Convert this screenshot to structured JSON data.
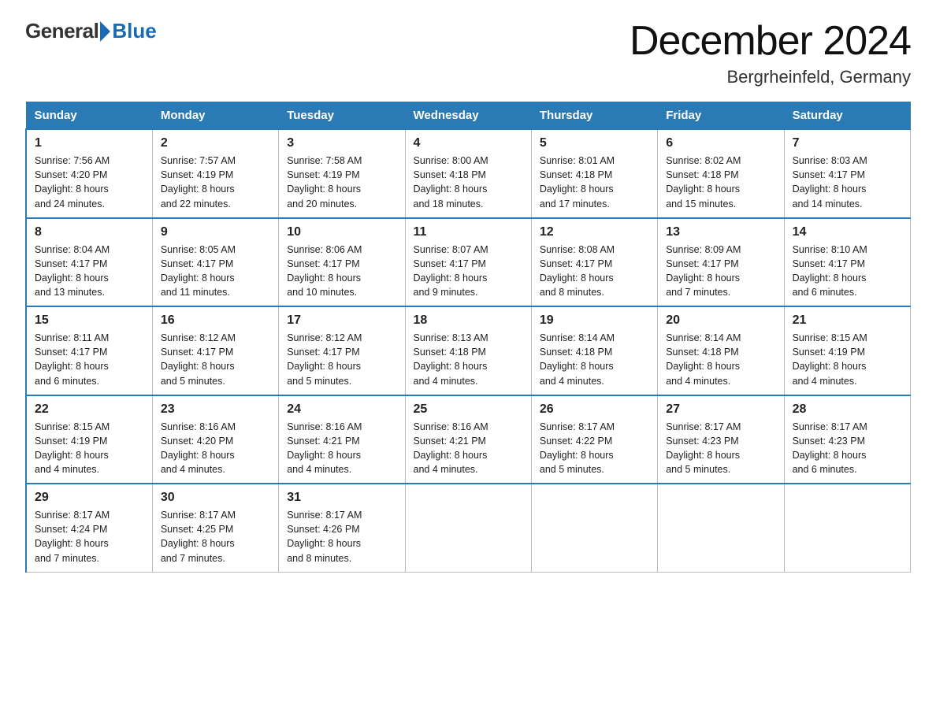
{
  "header": {
    "logo_general": "General",
    "logo_blue": "Blue",
    "title": "December 2024",
    "subtitle": "Bergrheinfeld, Germany"
  },
  "days_of_week": [
    "Sunday",
    "Monday",
    "Tuesday",
    "Wednesday",
    "Thursday",
    "Friday",
    "Saturday"
  ],
  "weeks": [
    [
      {
        "day": "1",
        "info": "Sunrise: 7:56 AM\nSunset: 4:20 PM\nDaylight: 8 hours\nand 24 minutes."
      },
      {
        "day": "2",
        "info": "Sunrise: 7:57 AM\nSunset: 4:19 PM\nDaylight: 8 hours\nand 22 minutes."
      },
      {
        "day": "3",
        "info": "Sunrise: 7:58 AM\nSunset: 4:19 PM\nDaylight: 8 hours\nand 20 minutes."
      },
      {
        "day": "4",
        "info": "Sunrise: 8:00 AM\nSunset: 4:18 PM\nDaylight: 8 hours\nand 18 minutes."
      },
      {
        "day": "5",
        "info": "Sunrise: 8:01 AM\nSunset: 4:18 PM\nDaylight: 8 hours\nand 17 minutes."
      },
      {
        "day": "6",
        "info": "Sunrise: 8:02 AM\nSunset: 4:18 PM\nDaylight: 8 hours\nand 15 minutes."
      },
      {
        "day": "7",
        "info": "Sunrise: 8:03 AM\nSunset: 4:17 PM\nDaylight: 8 hours\nand 14 minutes."
      }
    ],
    [
      {
        "day": "8",
        "info": "Sunrise: 8:04 AM\nSunset: 4:17 PM\nDaylight: 8 hours\nand 13 minutes."
      },
      {
        "day": "9",
        "info": "Sunrise: 8:05 AM\nSunset: 4:17 PM\nDaylight: 8 hours\nand 11 minutes."
      },
      {
        "day": "10",
        "info": "Sunrise: 8:06 AM\nSunset: 4:17 PM\nDaylight: 8 hours\nand 10 minutes."
      },
      {
        "day": "11",
        "info": "Sunrise: 8:07 AM\nSunset: 4:17 PM\nDaylight: 8 hours\nand 9 minutes."
      },
      {
        "day": "12",
        "info": "Sunrise: 8:08 AM\nSunset: 4:17 PM\nDaylight: 8 hours\nand 8 minutes."
      },
      {
        "day": "13",
        "info": "Sunrise: 8:09 AM\nSunset: 4:17 PM\nDaylight: 8 hours\nand 7 minutes."
      },
      {
        "day": "14",
        "info": "Sunrise: 8:10 AM\nSunset: 4:17 PM\nDaylight: 8 hours\nand 6 minutes."
      }
    ],
    [
      {
        "day": "15",
        "info": "Sunrise: 8:11 AM\nSunset: 4:17 PM\nDaylight: 8 hours\nand 6 minutes."
      },
      {
        "day": "16",
        "info": "Sunrise: 8:12 AM\nSunset: 4:17 PM\nDaylight: 8 hours\nand 5 minutes."
      },
      {
        "day": "17",
        "info": "Sunrise: 8:12 AM\nSunset: 4:17 PM\nDaylight: 8 hours\nand 5 minutes."
      },
      {
        "day": "18",
        "info": "Sunrise: 8:13 AM\nSunset: 4:18 PM\nDaylight: 8 hours\nand 4 minutes."
      },
      {
        "day": "19",
        "info": "Sunrise: 8:14 AM\nSunset: 4:18 PM\nDaylight: 8 hours\nand 4 minutes."
      },
      {
        "day": "20",
        "info": "Sunrise: 8:14 AM\nSunset: 4:18 PM\nDaylight: 8 hours\nand 4 minutes."
      },
      {
        "day": "21",
        "info": "Sunrise: 8:15 AM\nSunset: 4:19 PM\nDaylight: 8 hours\nand 4 minutes."
      }
    ],
    [
      {
        "day": "22",
        "info": "Sunrise: 8:15 AM\nSunset: 4:19 PM\nDaylight: 8 hours\nand 4 minutes."
      },
      {
        "day": "23",
        "info": "Sunrise: 8:16 AM\nSunset: 4:20 PM\nDaylight: 8 hours\nand 4 minutes."
      },
      {
        "day": "24",
        "info": "Sunrise: 8:16 AM\nSunset: 4:21 PM\nDaylight: 8 hours\nand 4 minutes."
      },
      {
        "day": "25",
        "info": "Sunrise: 8:16 AM\nSunset: 4:21 PM\nDaylight: 8 hours\nand 4 minutes."
      },
      {
        "day": "26",
        "info": "Sunrise: 8:17 AM\nSunset: 4:22 PM\nDaylight: 8 hours\nand 5 minutes."
      },
      {
        "day": "27",
        "info": "Sunrise: 8:17 AM\nSunset: 4:23 PM\nDaylight: 8 hours\nand 5 minutes."
      },
      {
        "day": "28",
        "info": "Sunrise: 8:17 AM\nSunset: 4:23 PM\nDaylight: 8 hours\nand 6 minutes."
      }
    ],
    [
      {
        "day": "29",
        "info": "Sunrise: 8:17 AM\nSunset: 4:24 PM\nDaylight: 8 hours\nand 7 minutes."
      },
      {
        "day": "30",
        "info": "Sunrise: 8:17 AM\nSunset: 4:25 PM\nDaylight: 8 hours\nand 7 minutes."
      },
      {
        "day": "31",
        "info": "Sunrise: 8:17 AM\nSunset: 4:26 PM\nDaylight: 8 hours\nand 8 minutes."
      },
      {
        "day": "",
        "info": ""
      },
      {
        "day": "",
        "info": ""
      },
      {
        "day": "",
        "info": ""
      },
      {
        "day": "",
        "info": ""
      }
    ]
  ]
}
